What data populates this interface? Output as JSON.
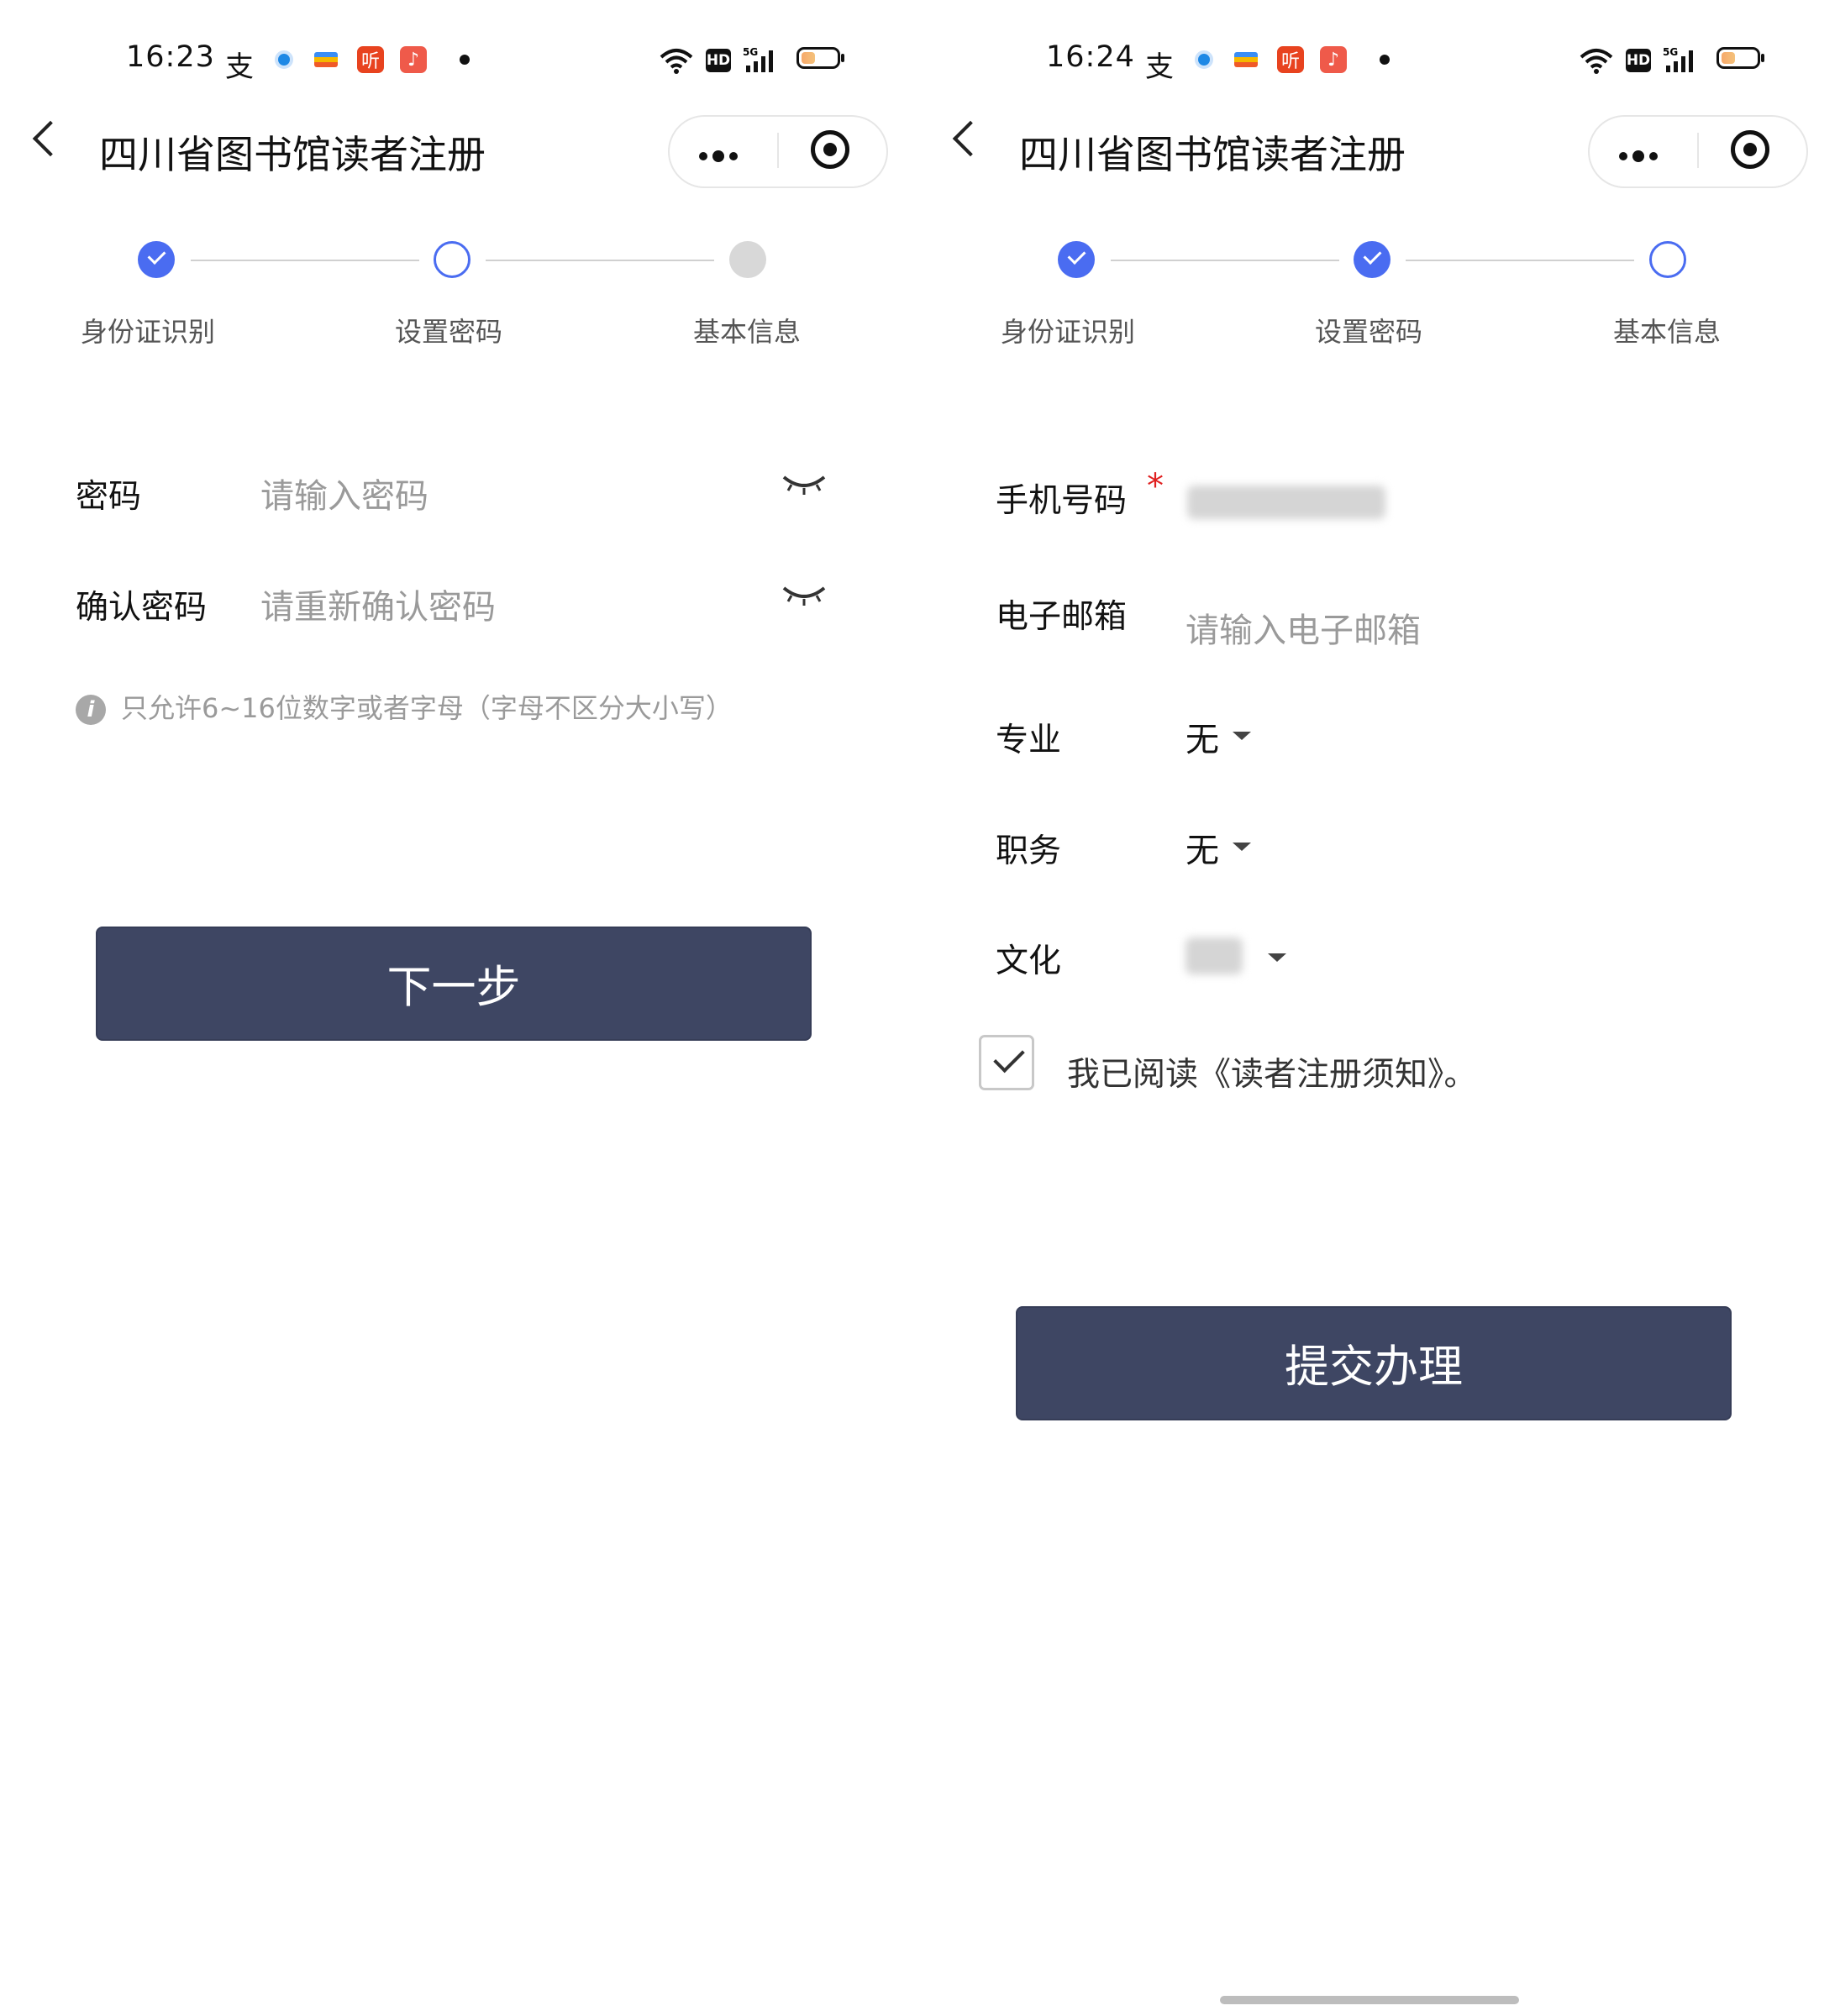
{
  "left": {
    "status_bar": {
      "time": "16:23",
      "notif_icons": [
        "支",
        "●",
        "▬",
        "听",
        "♪"
      ]
    },
    "title": "四川省图书馆读者注册",
    "steps": [
      {
        "label": "身份证识别",
        "state": "done"
      },
      {
        "label": "设置密码",
        "state": "current"
      },
      {
        "label": "基本信息",
        "state": "todo"
      }
    ],
    "password": {
      "label": "密码",
      "placeholder": "请输入密码"
    },
    "confirm": {
      "label": "确认密码",
      "placeholder": "请重新确认密码"
    },
    "hint": "只允许6~16位数字或者字母（字母不区分大小写）",
    "next_button": "下一步"
  },
  "right": {
    "status_bar": {
      "time": "16:24",
      "notif_icons": [
        "支",
        "●",
        "▬",
        "听",
        "♪"
      ]
    },
    "title": "四川省图书馆读者注册",
    "steps": [
      {
        "label": "身份证识别",
        "state": "done"
      },
      {
        "label": "设置密码",
        "state": "done"
      },
      {
        "label": "基本信息",
        "state": "current"
      }
    ],
    "phone": {
      "label": "手机号码",
      "required_mark": "*"
    },
    "email": {
      "label": "电子邮箱",
      "placeholder": "请输入电子邮箱"
    },
    "major": {
      "label": "专业",
      "value": "无"
    },
    "position": {
      "label": "职务",
      "value": "无"
    },
    "education": {
      "label": "文化"
    },
    "agreement": "我已阅读《读者注册须知》。",
    "submit_button": "提交办理"
  },
  "colors": {
    "accent": "#4a6cf1",
    "button": "#3e4663",
    "placeholder": "#9a9a9a",
    "required": "#e02020"
  }
}
